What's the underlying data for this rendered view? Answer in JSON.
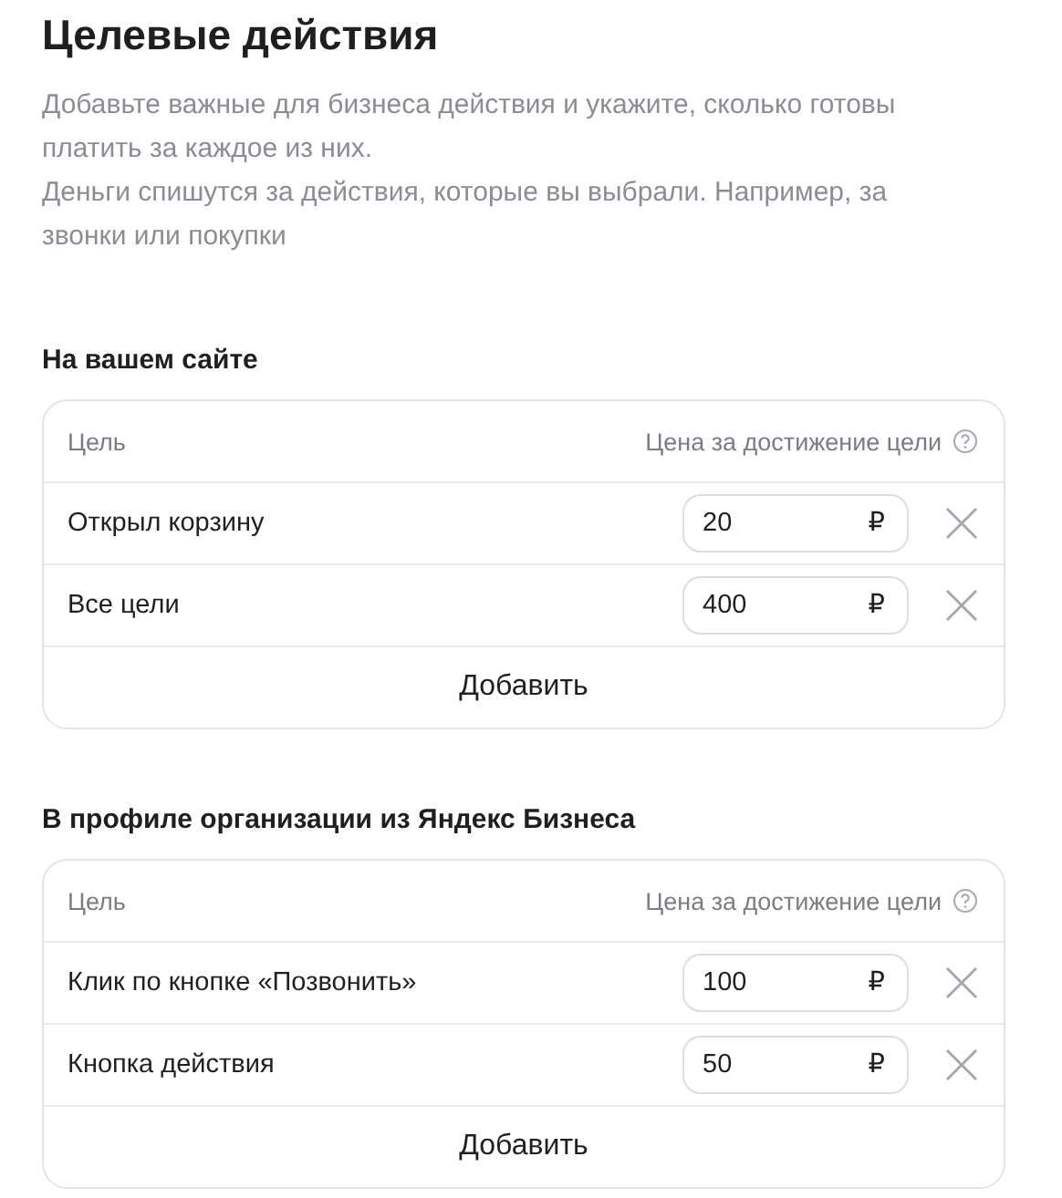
{
  "title": "Целевые действия",
  "description": [
    "Добавьте важные для бизнеса действия и укажите, сколько готовы платить за каждое из них.",
    "Деньги спишутся за действия, которые вы выбрали. Например, за звонки или покупки"
  ],
  "sections": [
    {
      "heading": "На вашем сайте",
      "columns": [
        "Цель",
        "Цена за достижение цели"
      ],
      "rows": [
        {
          "goal": "Открыл корзину",
          "price": "20",
          "currency": "₽"
        },
        {
          "goal": "Все цели",
          "price": "400",
          "currency": "₽"
        }
      ],
      "add_button": "Добавить"
    },
    {
      "heading": "В профиле организации из Яндекс Бизнеса",
      "columns": [
        "Цель",
        "Цена за достижение цели"
      ],
      "rows": [
        {
          "goal": "Клик по кнопке «Позвонить»",
          "price": "100",
          "currency": "₽"
        },
        {
          "goal": "Кнопка действия",
          "price": "50",
          "currency": "₽"
        }
      ],
      "add_button": "Добавить"
    }
  ]
}
